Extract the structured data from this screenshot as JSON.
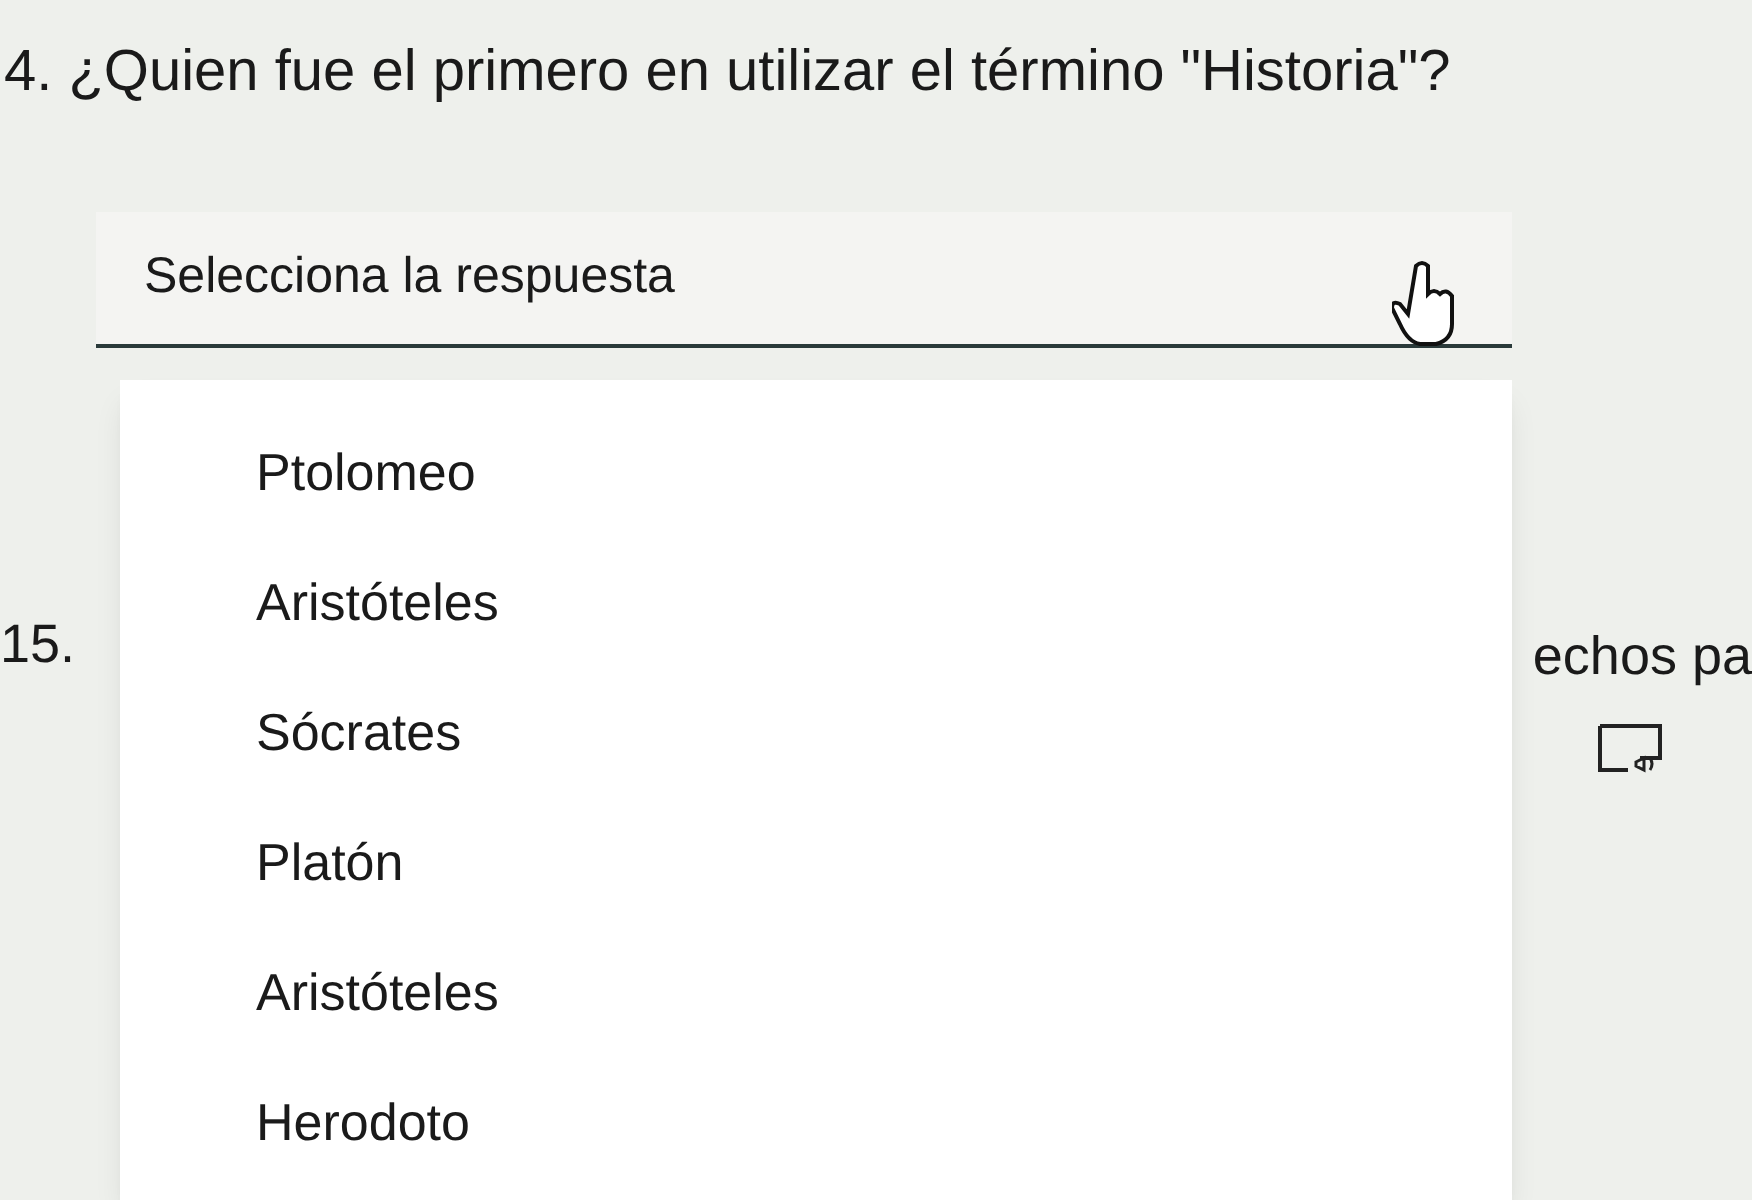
{
  "question": {
    "number": "4.",
    "text": "¿Quien fue el primero en utilizar el término \"Historia\"?"
  },
  "dropdown": {
    "placeholder": "Selecciona la respuesta",
    "expanded": true,
    "options": [
      {
        "label": "Ptolomeo",
        "selected": false
      },
      {
        "label": "Aristóteles",
        "selected": false
      },
      {
        "label": "Sócrates",
        "selected": false
      },
      {
        "label": "Platón",
        "selected": false
      },
      {
        "label": "Aristóteles",
        "selected": false
      },
      {
        "label": "Herodoto",
        "selected": false
      }
    ]
  },
  "next_question": {
    "number": "15.",
    "text": "echos pa"
  }
}
